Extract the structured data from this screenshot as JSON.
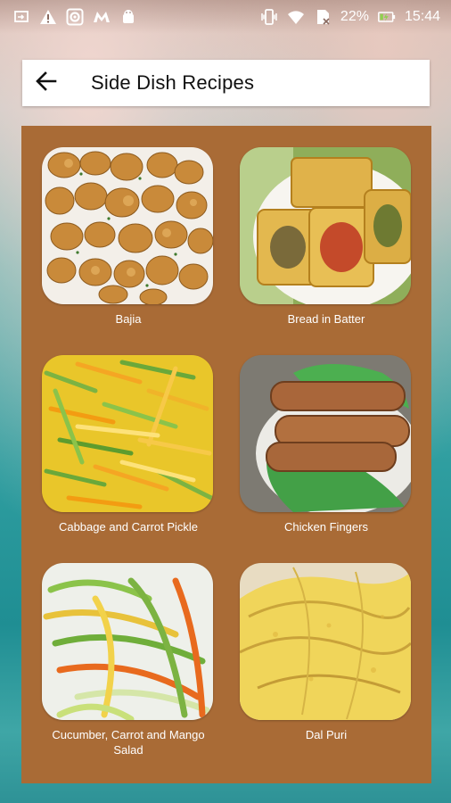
{
  "status_bar": {
    "battery_percent": "22%",
    "time": "15:44",
    "left_icons": [
      "screen-cast-icon",
      "warning-icon",
      "camera-app-icon",
      "m-app-icon",
      "android-icon"
    ],
    "right_icons": [
      "vibrate-icon",
      "wifi-icon",
      "sd-card-icon",
      "battery-charging-icon"
    ]
  },
  "toolbar": {
    "back_icon": "arrow-left-icon",
    "title": "Side Dish Recipes"
  },
  "theme": {
    "panel_color": "#a96b36",
    "toolbar_bg": "#ffffff"
  },
  "recipes": [
    {
      "name": "Bajia",
      "image": "bajia-fritters"
    },
    {
      "name": "Bread in Batter",
      "image": "bread-in-batter"
    },
    {
      "name": "Cabbage and Carrot Pickle",
      "image": "cabbage-carrot-pickle"
    },
    {
      "name": "Chicken Fingers",
      "image": "chicken-fingers"
    },
    {
      "name": "Cucumber, Carrot and Mango Salad",
      "image": "cucumber-carrot-mango-salad"
    },
    {
      "name": "Dal Puri",
      "image": "dal-puri"
    }
  ]
}
